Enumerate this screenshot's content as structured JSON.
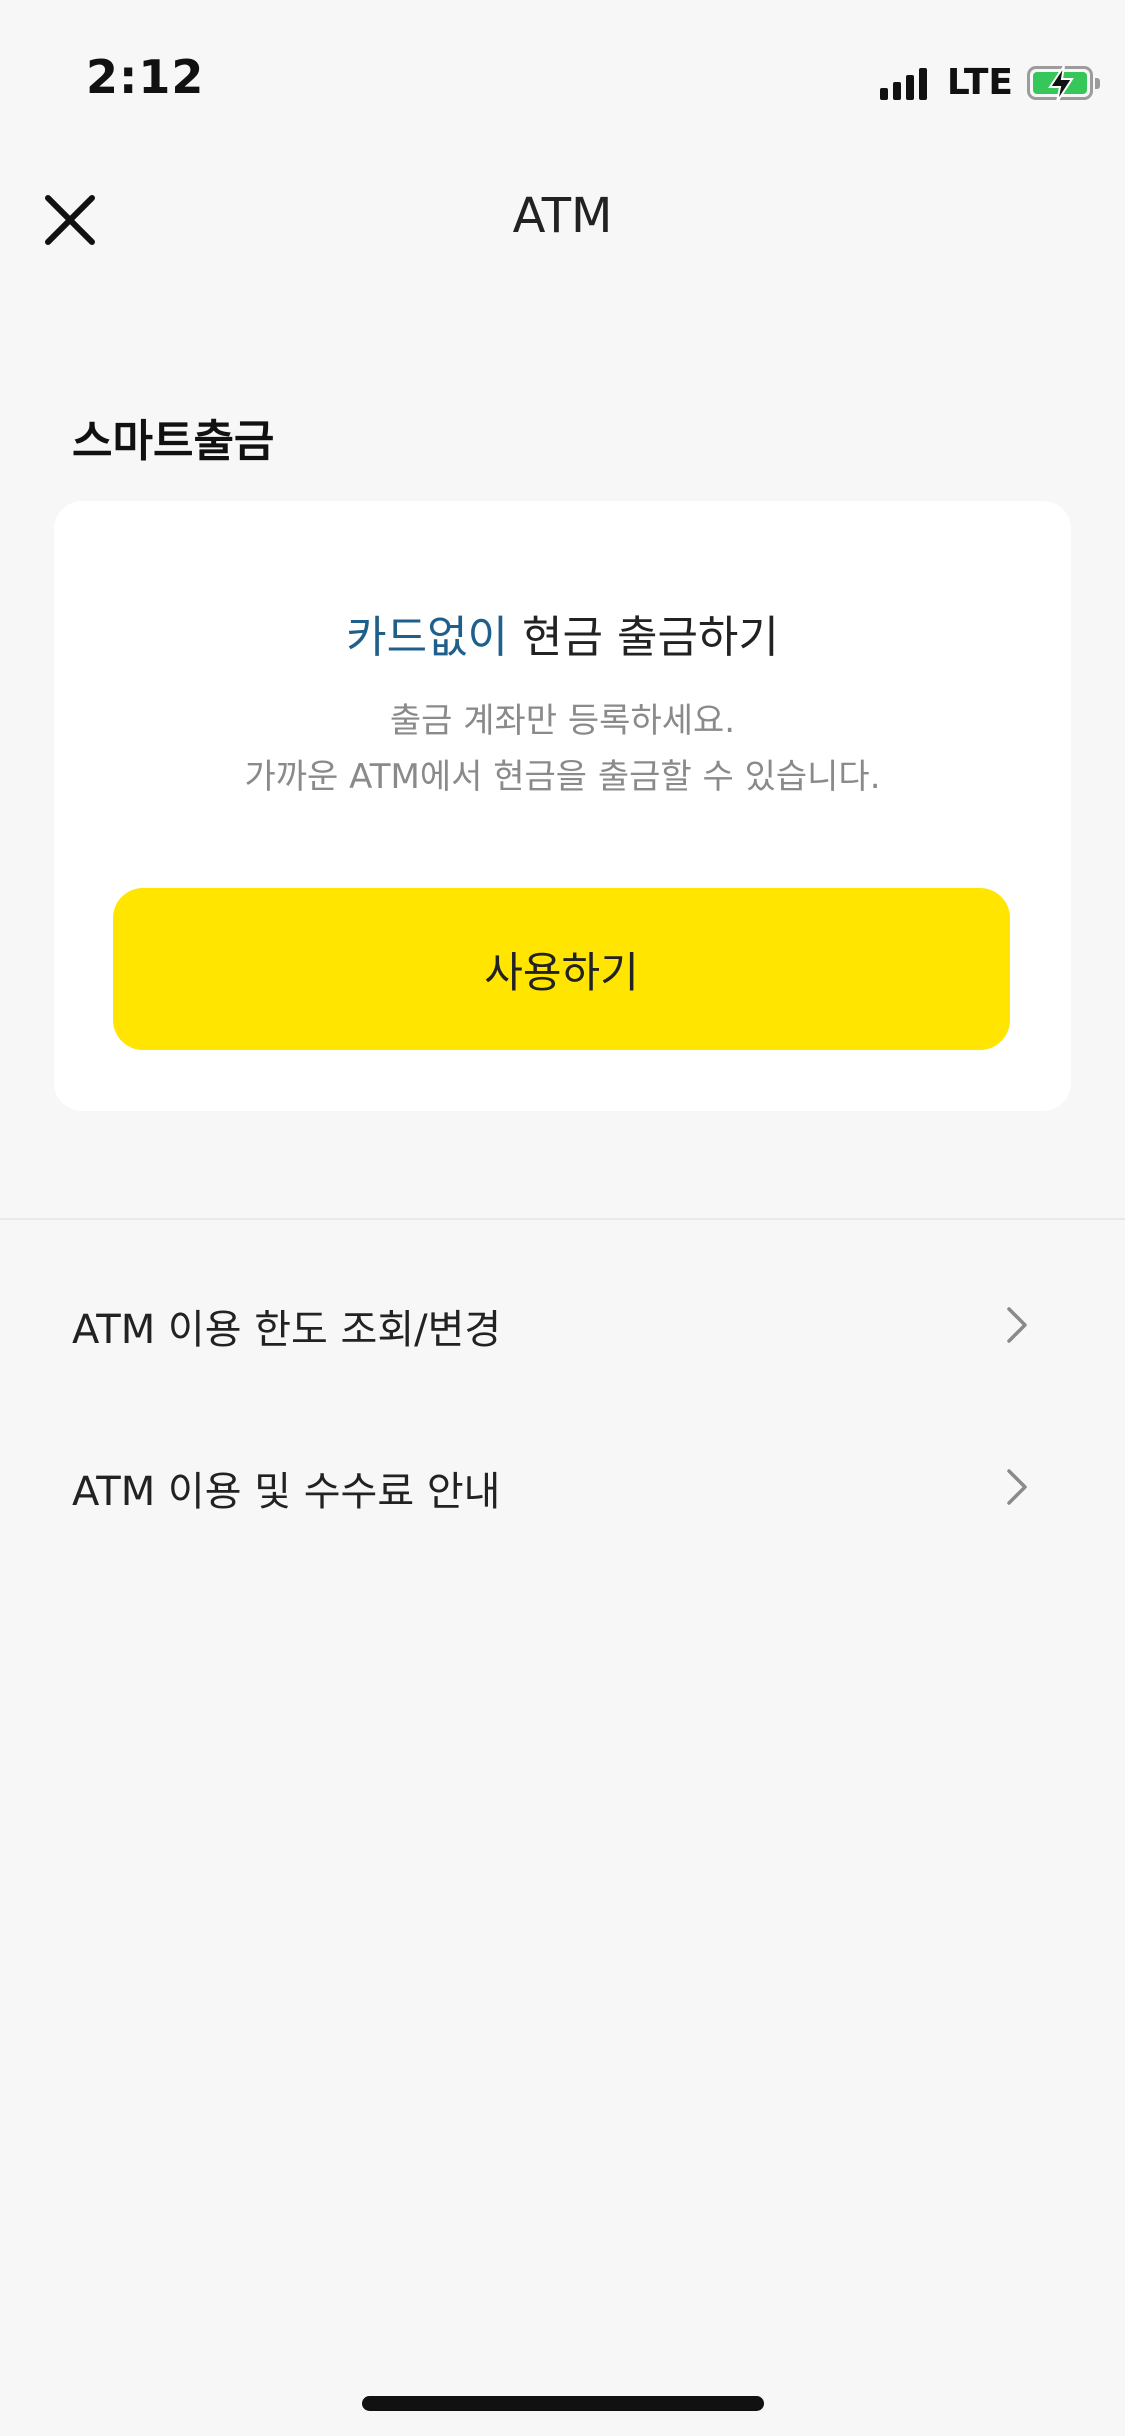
{
  "status_bar": {
    "time": "2:12",
    "network": "LTE",
    "signal_bars": 4,
    "battery_color": "#35c759"
  },
  "header": {
    "title": "ATM",
    "close_icon": "close-icon"
  },
  "section": {
    "title": "스마트출금"
  },
  "card": {
    "headline_accent": "카드없이",
    "headline_rest": " 현금 출금하기",
    "desc_line1": "출금 계좌만 등록하세요.",
    "desc_line2": "가까운 ATM에서 현금을 출금할 수 있습니다.",
    "button_label": "사용하기"
  },
  "menu": {
    "items": [
      {
        "label": "ATM 이용 한도 조회/변경",
        "icon": "chevron-right-icon"
      },
      {
        "label": "ATM 이용 및 수수료 안내",
        "icon": "chevron-right-icon"
      }
    ]
  },
  "colors": {
    "accent": "#1f5f8b",
    "button": "#ffe500",
    "background": "#f7f7f7"
  }
}
